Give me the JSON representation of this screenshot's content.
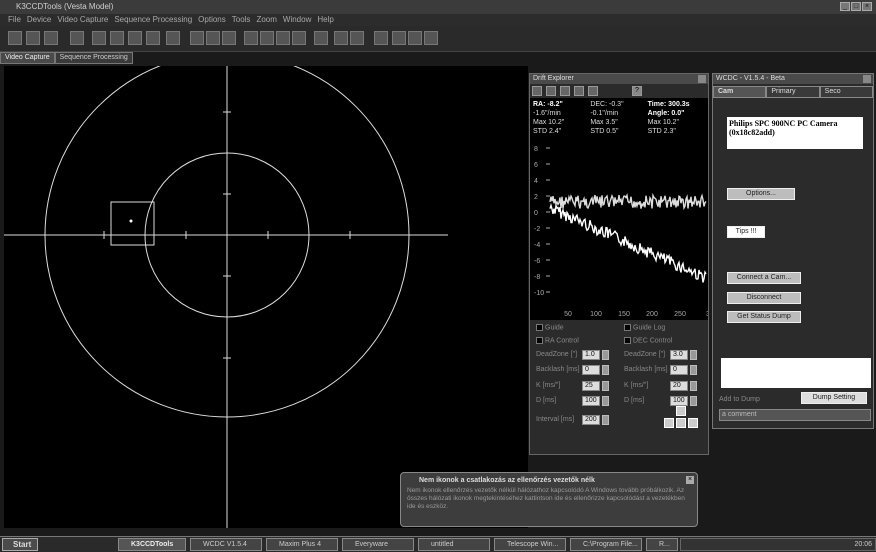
{
  "app": {
    "title": "K3CCDTools (Vesta Model)"
  },
  "menu": [
    "File",
    "Device",
    "Video Capture",
    "Sequence Processing",
    "Options",
    "Tools",
    "Zoom",
    "Window",
    "Help"
  ],
  "tabs": [
    "Video Capture",
    "Sequence Processing"
  ],
  "drift": {
    "title": "Drift Explorer",
    "help_icon": "?",
    "stats": {
      "ra_label": "RA:",
      "ra": "-8.2\"",
      "dec_label": "DEC:",
      "dec": "-0.3\"",
      "time_label": "Time:",
      "time": "300.3s",
      "ra_rate": "-1.6\"/min",
      "dec_rate": "-0.1\"/min",
      "angle_label": "Angle:",
      "angle": "0.0\"",
      "max1": "Max 10.2\"",
      "max2": "Max 3.5\"",
      "max3": "Max 10.2\"",
      "std1": "STD 2.4\"",
      "std2": "STD 0.5\"",
      "std3": "STD 2.3\""
    },
    "y_ticks": [
      "8",
      "6",
      "4",
      "2",
      "0",
      "-2",
      "-4",
      "-6",
      "-8",
      "-10"
    ],
    "x_ticks": [
      "50",
      "100",
      "150",
      "200",
      "250",
      "3"
    ],
    "controls": {
      "guide": "Guide",
      "guide_log": "Guide Log",
      "ra_control": "RA Control",
      "dec_control": "DEC Control",
      "deadzone_ra": "DeadZone [\"]",
      "deadzone_ra_val": "1.0",
      "deadzone_dec": "DeadZone [\"]",
      "deadzone_dec_val": "3.0",
      "backlash_ra": "Backlash [ms]",
      "backlash_ra_val": "0",
      "backlash_dec": "Backlash [ms]",
      "backlash_dec_val": "0",
      "k_ra": "K [ms/\"]",
      "k_ra_val": "25",
      "k_dec": "K [ms/\"]",
      "k_dec_val": "20",
      "d_ra": "D [ms]",
      "d_ra_val": "100",
      "d_dec": "D [ms]",
      "d_dec_val": "100",
      "interval": "Interval [ms]",
      "interval_val": "200"
    }
  },
  "wcam": {
    "title": "WCDC - V1.5.4 - Beta",
    "tabs": [
      "Cam",
      "Primary",
      "Seco"
    ],
    "camera_name": "Philips SPC 900NC PC Camera (0x18c82add)",
    "options": "Options...",
    "tips": "Tips !!!",
    "connect": "Connect a Cam...",
    "disconnect": "Disconnect",
    "get_status": "Get Status Dump",
    "add_to_dump": "Add to Dump",
    "dump_setting": "Dump Setting",
    "comment_placeholder": "a comment"
  },
  "notification": {
    "title": "Nem ikonok a csatlakozás az ellenőrzés vezetők nélk",
    "body": "Nem ikonok ellenőrzés vezetők nélkül hálózathoz kapcsolódó A Windows tovább próbálkozik. Az összes hálózati ikonok megtekintéséhez kattintson ide és ellenőrizze kapcsolódást a vezetékben ide és eszköz."
  },
  "taskbar": {
    "start": "Start",
    "tasks": [
      "K3CCDTools",
      "WCDC V1.5.4",
      "Maxim Plus 4",
      "Everyware",
      "untitled",
      "Telescope Win...",
      "C:\\Program File...",
      "R..."
    ],
    "clock": "20:06"
  }
}
